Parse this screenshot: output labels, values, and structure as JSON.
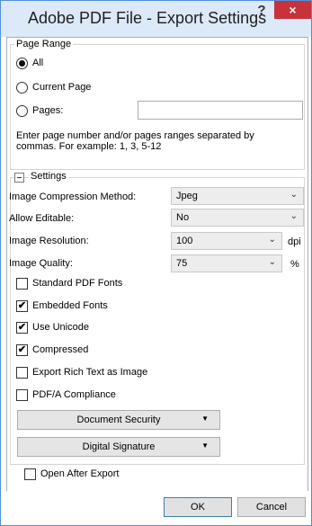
{
  "window": {
    "title": "Adobe PDF File - Export Settings",
    "help_glyph": "?",
    "close_glyph": "×"
  },
  "page_range": {
    "legend": "Page Range",
    "options": [
      {
        "label": "All",
        "checked": true
      },
      {
        "label": "Current Page",
        "checked": false
      },
      {
        "label": "Pages:",
        "checked": false
      }
    ],
    "pages_value": "",
    "hint_line1": "Enter page number and/or pages ranges separated by",
    "hint_line2": "commas. For example: 1, 3, 5-12"
  },
  "settings": {
    "legend": "Settings",
    "image_compression": {
      "label": "Image Compression Method:",
      "value": "Jpeg"
    },
    "allow_editable": {
      "label": "Allow Editable:",
      "value": "No"
    },
    "image_resolution": {
      "label": "Image Resolution:",
      "value": "100",
      "unit": "dpi"
    },
    "image_quality": {
      "label": "Image Quality:",
      "value": "75",
      "unit": "%"
    },
    "checkboxes": [
      {
        "label": "Standard PDF Fonts",
        "checked": false
      },
      {
        "label": "Embedded Fonts",
        "checked": true
      },
      {
        "label": "Use Unicode",
        "checked": true
      },
      {
        "label": "Compressed",
        "checked": true
      },
      {
        "label": "Export Rich Text as Image",
        "checked": false
      },
      {
        "label": "PDF/A Compliance",
        "checked": false
      }
    ],
    "document_security_label": "Document Security",
    "digital_signature_label": "Digital Signature"
  },
  "open_after_export": {
    "label": "Open After Export",
    "checked": false
  },
  "buttons": {
    "ok": "OK",
    "cancel": "Cancel"
  },
  "glyphs": {
    "check": "✔",
    "dropdown": "⌄",
    "split_arrow": "▼"
  }
}
